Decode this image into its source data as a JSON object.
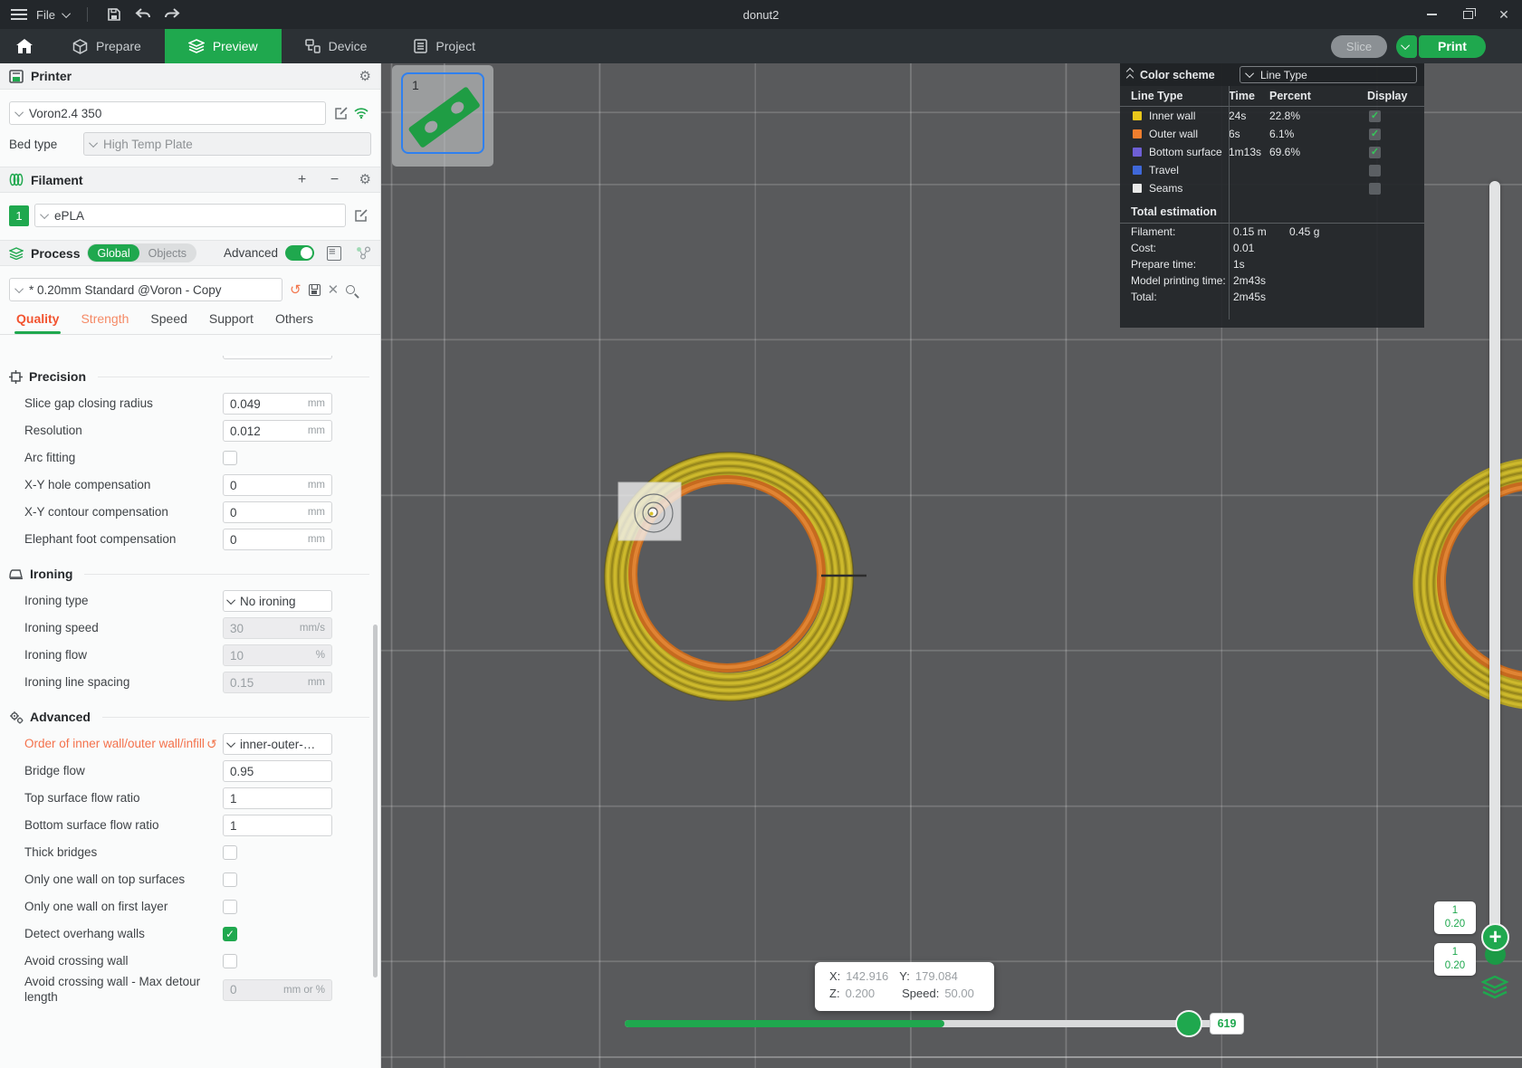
{
  "window": {
    "title": "donut2",
    "menu_label": "File"
  },
  "nav": {
    "tabs": [
      {
        "label": "Prepare",
        "state": "normal",
        "icon": "cube-icon"
      },
      {
        "label": "Preview",
        "state": "active",
        "icon": "layers-icon"
      },
      {
        "label": "Device",
        "state": "normal",
        "icon": "device-icon"
      },
      {
        "label": "Project",
        "state": "normal",
        "icon": "document-icon"
      }
    ],
    "slice_label": "Slice",
    "print_label": "Print"
  },
  "printer": {
    "title": "Printer",
    "preset": "Voron2.4 350",
    "bed_type_label": "Bed type",
    "bed_type_value": "High Temp Plate"
  },
  "filament": {
    "title": "Filament",
    "slot": "1",
    "preset": "ePLA"
  },
  "process": {
    "title": "Process",
    "scope_options": [
      "Global",
      "Objects"
    ],
    "scope_selected": "Global",
    "advanced_label": "Advanced",
    "preset": "* 0.20mm Standard @Voron - Copy",
    "tabs": [
      {
        "label": "Quality",
        "state": "active"
      },
      {
        "label": "Strength",
        "state": "modified"
      },
      {
        "label": "Speed",
        "state": "normal"
      },
      {
        "label": "Support",
        "state": "normal"
      },
      {
        "label": "Others",
        "state": "normal"
      }
    ]
  },
  "settings": {
    "sections": [
      {
        "title": "Precision",
        "icon": "precision-icon",
        "rows": [
          {
            "label": "Slice gap closing radius",
            "type": "input",
            "value": "0.049",
            "unit": "mm"
          },
          {
            "label": "Resolution",
            "type": "input",
            "value": "0.012",
            "unit": "mm"
          },
          {
            "label": "Arc fitting",
            "type": "checkbox",
            "checked": false
          },
          {
            "label": "X-Y hole compensation",
            "type": "input",
            "value": "0",
            "unit": "mm"
          },
          {
            "label": "X-Y contour compensation",
            "type": "input",
            "value": "0",
            "unit": "mm"
          },
          {
            "label": "Elephant foot compensation",
            "type": "input",
            "value": "0",
            "unit": "mm"
          }
        ]
      },
      {
        "title": "Ironing",
        "icon": "ironing-icon",
        "rows": [
          {
            "label": "Ironing type",
            "type": "select",
            "value": "No ironing"
          },
          {
            "label": "Ironing speed",
            "type": "input",
            "value": "30",
            "unit": "mm/s",
            "disabled": true
          },
          {
            "label": "Ironing flow",
            "type": "input",
            "value": "10",
            "unit": "%",
            "disabled": true
          },
          {
            "label": "Ironing line spacing",
            "type": "input",
            "value": "0.15",
            "unit": "mm",
            "disabled": true
          }
        ]
      },
      {
        "title": "Advanced",
        "icon": "advanced-icon",
        "rows": [
          {
            "label": "Order of inner wall/outer wall/infill",
            "type": "select",
            "value": "inner-outer-…",
            "modified": true
          },
          {
            "label": "Bridge flow",
            "type": "input",
            "value": "0.95",
            "unit": ""
          },
          {
            "label": "Top surface flow ratio",
            "type": "input",
            "value": "1",
            "unit": ""
          },
          {
            "label": "Bottom surface flow ratio",
            "type": "input",
            "value": "1",
            "unit": ""
          },
          {
            "label": "Thick bridges",
            "type": "checkbox",
            "checked": false
          },
          {
            "label": "Only one wall on top surfaces",
            "type": "checkbox",
            "checked": false
          },
          {
            "label": "Only one wall on first layer",
            "type": "checkbox",
            "checked": false
          },
          {
            "label": "Detect overhang walls",
            "type": "checkbox",
            "checked": true
          },
          {
            "label": "Avoid crossing wall",
            "type": "checkbox",
            "checked": false
          },
          {
            "label": "Avoid crossing wall - Max detour length",
            "type": "input",
            "value": "0",
            "unit": "mm or %",
            "disabled": true
          }
        ]
      }
    ]
  },
  "legend": {
    "title": "Color scheme",
    "mode": "Line Type",
    "columns": [
      "Line Type",
      "Time",
      "Percent",
      "Display"
    ],
    "rows": [
      {
        "name": "Inner wall",
        "swatch": "#e9c71b",
        "time": "24s",
        "percent": "22.8%",
        "display": true
      },
      {
        "name": "Outer wall",
        "swatch": "#ef7e2e",
        "time": "6s",
        "percent": "6.1%",
        "display": true
      },
      {
        "name": "Bottom surface",
        "swatch": "#6e5fd5",
        "time": "1m13s",
        "percent": "69.6%",
        "display": true
      },
      {
        "name": "Travel",
        "swatch": "#3f68d9",
        "time": "",
        "percent": "",
        "display": false
      },
      {
        "name": "Seams",
        "swatch": "#e9e9e9",
        "time": "",
        "percent": "",
        "display": false
      }
    ],
    "totals_title": "Total estimation",
    "totals": [
      {
        "label": "Filament:",
        "value": "0.15 m",
        "value2": "0.45 g"
      },
      {
        "label": "Cost:",
        "value": "0.01",
        "value2": ""
      },
      {
        "label": "Prepare time:",
        "value": "1s",
        "value2": ""
      },
      {
        "label": "Model printing time:",
        "value": "2m43s",
        "value2": ""
      },
      {
        "label": "Total:",
        "value": "2m45s",
        "value2": ""
      }
    ]
  },
  "viewport": {
    "plate_number": "1",
    "tooltip": {
      "x_label": "X:",
      "x_value": "142.916",
      "y_label": "Y:",
      "y_value": "179.084",
      "z_label": "Z:",
      "z_value": "0.200",
      "speed_label": "Speed:",
      "speed_value": "50.00"
    },
    "layer_slider": {
      "top_badge": [
        "1",
        "0.20"
      ],
      "bottom_badge": [
        "1",
        "0.20"
      ]
    },
    "move_slider": {
      "value": "619"
    }
  }
}
